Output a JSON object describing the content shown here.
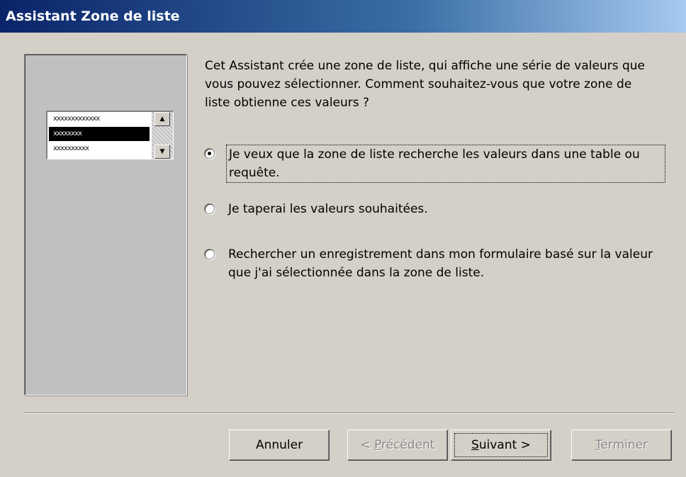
{
  "window": {
    "title": "Assistant Zone de liste"
  },
  "preview": {
    "rows": [
      "xxxxxxxxxxxxx",
      "xxxxxxxx",
      "xxxxxxxxxx"
    ],
    "selected_index": 1,
    "scroll_up_icon": "triangle-up",
    "scroll_down_icon": "triangle-down"
  },
  "description": "Cet Assistant crée une zone de liste, qui affiche une série de valeurs que vous pouvez sélectionner. Comment souhaitez-vous que votre zone de liste obtienne ces valeurs ?",
  "options": [
    {
      "label": "Je veux que la zone de liste recherche les valeurs dans une table ou requête.",
      "selected": true
    },
    {
      "label": "Je taperai les valeurs souhaitées.",
      "selected": false
    },
    {
      "label": "Rechercher un enregistrement dans mon formulaire basé sur la valeur que j'ai sélectionnée dans la zone de liste.",
      "selected": false
    }
  ],
  "buttons": {
    "cancel": {
      "label": "Annuler",
      "enabled": true
    },
    "previous": {
      "label_prefix": "< ",
      "accel": "P",
      "label_rest": "récédent",
      "enabled": false
    },
    "next": {
      "accel": "S",
      "label_rest": "uivant >",
      "enabled": true
    },
    "finish": {
      "accel": "T",
      "label_rest": "erminer",
      "enabled": false
    }
  }
}
